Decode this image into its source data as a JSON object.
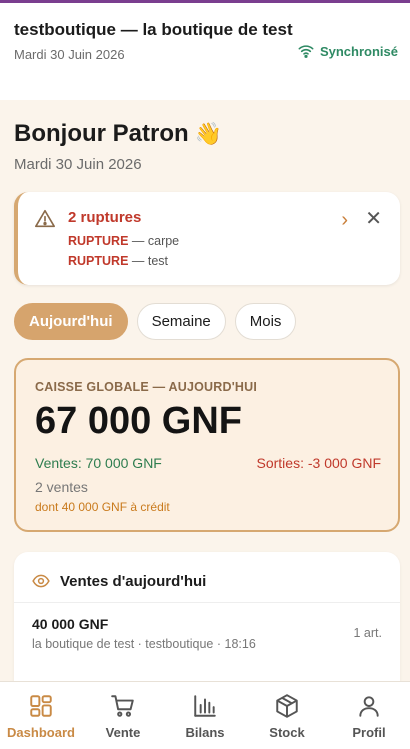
{
  "header": {
    "shop_name": "testboutique — la boutique de test",
    "date": "Mardi 30 Juin 2026",
    "sync_label": "Synchronisé"
  },
  "greeting": {
    "title": "Bonjour Patron",
    "emoji": "👋",
    "date": "Mardi 30 Juin 2026"
  },
  "alert": {
    "title": "2 ruptures",
    "items": [
      {
        "tag": "RUPTURE",
        "text": " — carpe"
      },
      {
        "tag": "RUPTURE",
        "text": " — test"
      }
    ]
  },
  "tabs": [
    {
      "label": "Aujourd'hui",
      "active": true
    },
    {
      "label": "Semaine",
      "active": false
    },
    {
      "label": "Mois",
      "active": false
    }
  ],
  "caisse": {
    "label": "CAISSE GLOBALE — AUJOURD'HUI",
    "total": "67 000 GNF",
    "ventes": "Ventes: 70 000 GNF",
    "sorties": "Sorties: -3 000 GNF",
    "count": "2 ventes",
    "credit": "dont 40 000 GNF à crédit"
  },
  "sales": {
    "title": "Ventes d'aujourd'hui",
    "items": [
      {
        "amount": "40 000 GNF",
        "meta": "la boutique de test · testboutique · 18:16",
        "qty": "1 art."
      }
    ]
  },
  "nav": [
    {
      "label": "Dashboard",
      "icon": "dashboard-icon",
      "active": true
    },
    {
      "label": "Vente",
      "icon": "cart-icon",
      "active": false
    },
    {
      "label": "Bilans",
      "icon": "bar-chart-icon",
      "active": false
    },
    {
      "label": "Stock",
      "icon": "box-icon",
      "active": false
    },
    {
      "label": "Profil",
      "icon": "user-icon",
      "active": false
    }
  ],
  "colors": {
    "accent": "#d6a46d",
    "danger": "#c0392b",
    "success": "#2e7d4f"
  }
}
